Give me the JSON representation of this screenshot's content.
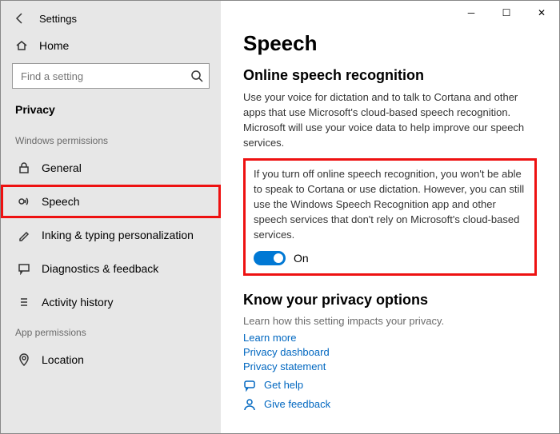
{
  "window": {
    "title": "Settings"
  },
  "sidebar": {
    "home": "Home",
    "search_placeholder": "Find a setting",
    "category": "Privacy",
    "sections": {
      "windows": "Windows permissions",
      "app": "App permissions"
    },
    "items": {
      "general": "General",
      "speech": "Speech",
      "inking": "Inking & typing personalization",
      "diagnostics": "Diagnostics & feedback",
      "activity": "Activity history",
      "location": "Location"
    }
  },
  "main": {
    "title": "Speech",
    "subtitle": "Online speech recognition",
    "para1": "Use your voice for dictation and to talk to Cortana and other apps that use Microsoft's cloud-based speech recognition. Microsoft will use your voice data to help improve our speech services.",
    "para2": "If you turn off online speech recognition, you won't be able to speak to Cortana or use dictation. However, you can still use the Windows Speech Recognition app and other speech services that don't rely on Microsoft's cloud-based services.",
    "toggle_state": "On",
    "know_heading": "Know your privacy options",
    "know_sub": "Learn how this setting impacts your privacy.",
    "links": {
      "learn": "Learn more",
      "dashboard": "Privacy dashboard",
      "statement": "Privacy statement"
    },
    "help": "Get help",
    "feedback": "Give feedback"
  }
}
